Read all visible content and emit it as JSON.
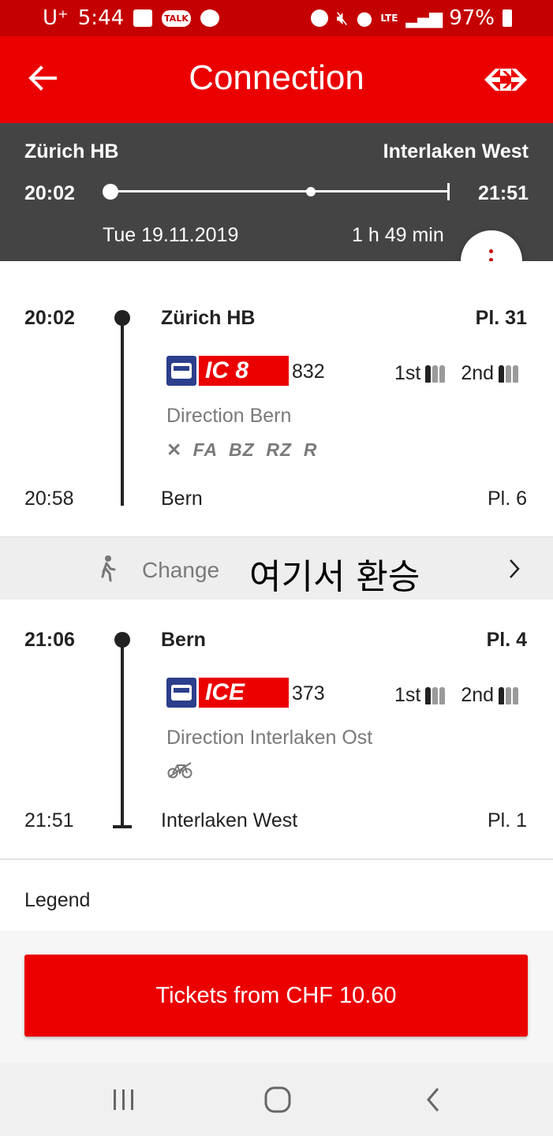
{
  "status_bar": {
    "carrier": "U⁺",
    "time": "5:44",
    "talk_label": "TALK",
    "lte_label": "LTE",
    "battery": "97%"
  },
  "app_bar": {
    "title": "Connection",
    "back_icon": "arrow-left-icon",
    "logo_icon": "sbb-logo-icon"
  },
  "summary": {
    "from": "Zürich HB",
    "to": "Interlaken West",
    "dep_time": "20:02",
    "arr_time": "21:51",
    "date": "Tue 19.11.2019",
    "duration": "1 h 49 min"
  },
  "legs": [
    {
      "dep_time": "20:02",
      "dep_station": "Zürich HB",
      "dep_platform": "Pl. 31",
      "train_label": "IC 8",
      "train_number": "832",
      "first_class": "1st",
      "second_class": "2nd",
      "direction": "Direction Bern",
      "facilities": "FA  BZ  RZ  R",
      "arr_time": "20:58",
      "arr_station": "Bern",
      "arr_platform": "Pl. 6"
    },
    {
      "dep_time": "21:06",
      "dep_station": "Bern",
      "dep_platform": "Pl. 4",
      "train_label": "ICE",
      "train_number": "373",
      "first_class": "1st",
      "second_class": "2nd",
      "direction": "Direction Interlaken Ost",
      "arr_time": "21:51",
      "arr_station": "Interlaken West",
      "arr_platform": "Pl. 1"
    }
  ],
  "change": {
    "label": "Change",
    "annotation": "여기서 환승"
  },
  "legend_label": "Legend",
  "tickets_button": "Tickets from CHF 10.60",
  "colors": {
    "brand_red": "#eb0000",
    "status_red": "#c40000",
    "summary_grey": "#444444"
  }
}
